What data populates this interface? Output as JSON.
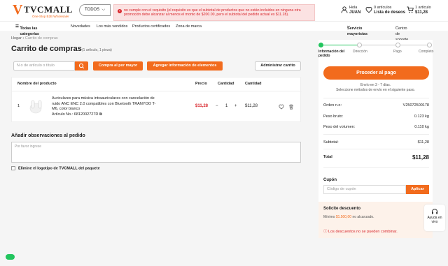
{
  "header": {
    "logo_text": "TVCMALL",
    "logo_sub": "One-Stop B2B Wholesaler",
    "search_category": "TODOS",
    "alert": "no cumple con el requisito (el requisito es que el subtotal de productos que no están incluidos en ninguna otra promoción debe alcanzar al menos el monto de $200.00, pero el subtotal del pedido actual es $11.28).",
    "greeting": "Hola",
    "user": "JUAN",
    "wishlist_count": "0 artículos",
    "wishlist_label": "Lista de deseos",
    "cart_count": "1 artículo",
    "cart_total": "$11,28"
  },
  "nav": {
    "categories": "Todas las categorías",
    "items": [
      "Novedades",
      "Los más vendidos",
      "Productos certificados",
      "Zona de marca"
    ],
    "wholesale": "Servicio mayoristas",
    "support": "Centro de soporte"
  },
  "breadcrumb": {
    "home": "Hogar",
    "current": "Carrito de compras"
  },
  "page": {
    "title": "Carrito de compras",
    "count": "(1 artículo, 1 pieza)"
  },
  "toolbar": {
    "article_placeholder": "N.o de artículo o título",
    "bulk_buy": "Compra al por mayor",
    "add_items": "Agregar información de elementos",
    "manage_cart": "Administrar carrito"
  },
  "table": {
    "headers": {
      "product": "Nombre del producto",
      "price": "Precio",
      "qty": "Cantidad",
      "qty2": "Cantidad"
    },
    "rows": [
      {
        "index": "1",
        "name": "Auriculares para música intraauriculares con cancelación de ruido ANC ENC 2.0 compatibles con Bluetooth TRANYOO T-M6, color blanco",
        "article": "Artículo No.: 6812002727D",
        "price": "$11,28",
        "quantity": "1",
        "subtotal": "$11,28"
      }
    ]
  },
  "observations": {
    "title": "Añadir observaciones al pedido",
    "placeholder": "Por favor ingrese"
  },
  "remove_logo": "Elimine el logotipo de TVCMALL del paquete",
  "summary": {
    "steps": [
      "Información del pedido",
      "Dirección",
      "Pago",
      "Completo"
    ],
    "proceed": "Proceder al pago",
    "ship_line1": "Envío en 3 - 7 días.",
    "ship_line2": "Seleccione métodos de envío en el siguiente paso.",
    "order_label": "Orden n.o:",
    "order_value": "V25072500178",
    "gross_label": "Peso bruto:",
    "gross_value": "0.123 kg",
    "vol_label": "Peso del volumen:",
    "vol_value": "0.110 kg",
    "subtotal_label": "Subtotal:",
    "subtotal_value": "$11,28",
    "total_label": "Total",
    "total_value": "$11,28",
    "coupon_label": "Cupón",
    "coupon_placeholder": "Código de cupón",
    "coupon_apply": "Aplicar",
    "discount_label": "Solicite descuento",
    "discount_min_prefix": "Mínimo",
    "discount_min_amount": "$1.500,00",
    "discount_min_suffix": "no alcanzado.",
    "discount_note": "Los descuentos no se pueden combinar."
  },
  "help": {
    "line1": "Ayuda en",
    "line2": "vivo"
  },
  "colors": {
    "accent": "#f26b1d",
    "error": "#d8262c",
    "success": "#22c55e"
  }
}
